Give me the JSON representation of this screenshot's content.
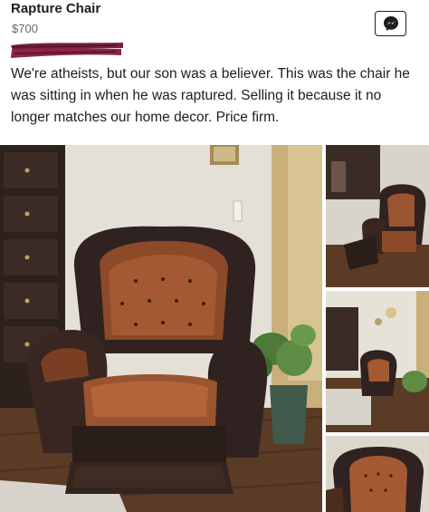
{
  "listing": {
    "title": "Rapture Chair",
    "price": "$700",
    "description": "We're atheists, but our son was a believer. This was the chair he was sitting in when he was raptured. Selling it because it no longer matches our home decor. Price firm."
  },
  "icons": {
    "message": "messenger-icon",
    "redaction": "redaction-scribble"
  },
  "colors": {
    "redaction": "#7a1f3d",
    "leather_dark": "#2f2220",
    "leather_tan": "#a0552d",
    "wall": "#e4e0d8",
    "floor": "#5a3b26"
  },
  "gallery": {
    "photos": [
      "main-photo",
      "thumbnail-1",
      "thumbnail-2",
      "thumbnail-3"
    ]
  }
}
